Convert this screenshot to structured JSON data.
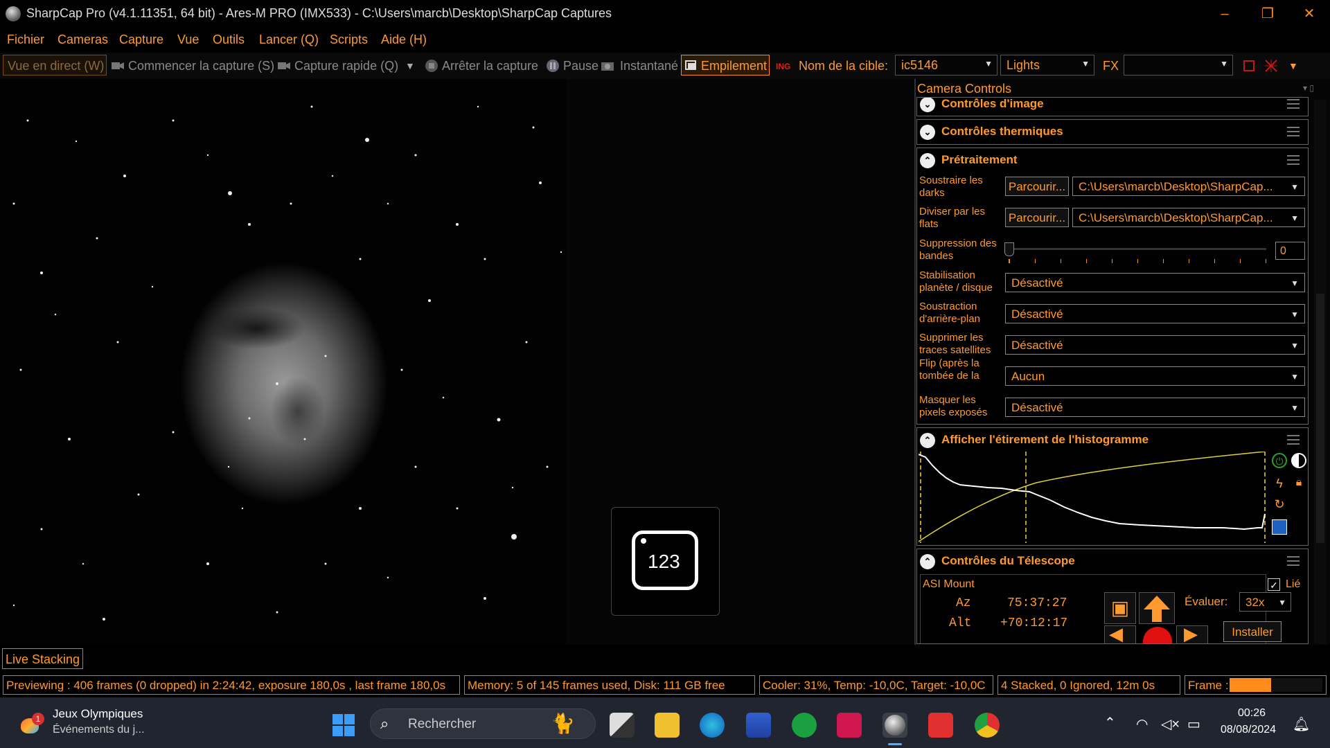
{
  "window": {
    "title": "SharpCap Pro (v4.1.11351, 64 bit) - Ares-M PRO (IMX533) - C:\\Users\\marcb\\Desktop\\SharpCap Captures",
    "minimize": "–",
    "restore": "❐",
    "close": "✕"
  },
  "menu": [
    "Fichier",
    "Cameras",
    "Capture",
    "Vue",
    "Outils",
    "Lancer (Q)",
    "Scripts",
    "Aide (H)"
  ],
  "toolbar": {
    "live_view": "Vue en direct (W)",
    "start_capture": "Commencer la capture (S)",
    "quick_capture": "Capture rapide (Q)",
    "stop_capture": "Arrêter la capture",
    "pause": "Pause",
    "snapshot": "Instantané",
    "stacking": "Empilement",
    "target_label": "Nom de la cible:",
    "target_value": "ic5146",
    "frame_type": "Lights",
    "fx_label": "FX",
    "fx_value": ""
  },
  "panel": {
    "header": "Camera Controls",
    "sections": {
      "image_controls": "Contrôles d'image",
      "thermal_controls": "Contrôles thermiques",
      "preprocessing": "Prétraitement",
      "histogram": "Afficher l'étirement de l'histogramme",
      "telescope": "Contrôles du Télescope"
    },
    "preproc": {
      "darks_label": "Soustraire les darks",
      "browse": "Parcourir...",
      "darks_path": "C:\\Users\\marcb\\Desktop\\SharpCap...",
      "flats_label": "Diviser par les flats",
      "flats_path": "C:\\Users\\marcb\\Desktop\\SharpCap...",
      "banding_label": "Suppression des bandes",
      "banding_value": "0",
      "stab_label": "Stabilisation planète / disque",
      "stab_value": "Désactivé",
      "bg_label": "Soustraction d'arrière-plan",
      "bg_value": "Désactivé",
      "sat_label": "Supprimer les traces satellites",
      "sat_value": "Désactivé",
      "flip_label": "Flip (après la tombée de la nuit/à plat)",
      "flip_value": "Aucun",
      "mask_label": "Masquer les pixels exposés",
      "mask_value": "Désactivé"
    },
    "telescope": {
      "mount": "ASI Mount",
      "linked": "Lié",
      "az_label": "Az",
      "az_value": "75:37:27",
      "alt_label": "Alt",
      "alt_value": "+70:12:17",
      "rate_label": "Évaluer:",
      "rate_value": "32x",
      "install": "Installer"
    }
  },
  "overlay": {
    "counter": "123"
  },
  "status": {
    "tab": "Live Stacking",
    "preview": "Previewing : 406 frames (0 dropped) in 2:24:42, exposure 180,0s , last frame 180,0s",
    "memory": "Memory: 5 of 145 frames used, Disk: 111 GB free",
    "cooler": "Cooler: 31%, Temp: -10,0C, Target: -10,0C",
    "stacked": "4 Stacked, 0 Ignored, 12m 0s",
    "frame_label": "Frame :",
    "frame_progress": 0.45
  },
  "taskbar": {
    "news_title": "Jeux Olympiques",
    "news_sub": "Événements du j...",
    "news_badge": "1",
    "search": "Rechercher",
    "time": "00:26",
    "date": "08/08/2024"
  }
}
